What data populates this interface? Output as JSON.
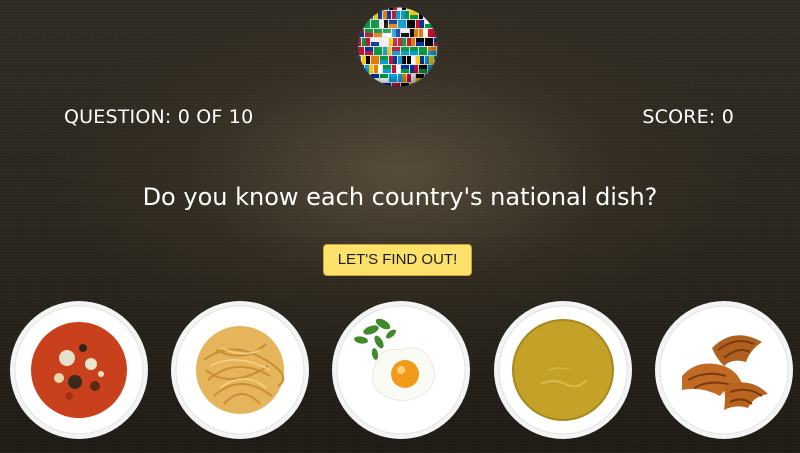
{
  "header": {
    "logo_icon": "flag-globe-icon"
  },
  "hud": {
    "question_counter": "QUESTION: 0 OF 10",
    "score": "SCORE: 0"
  },
  "prompt": {
    "text": "Do you know each country's national dish?"
  },
  "start_button": {
    "label": "LET'S FIND OUT!",
    "color": "#fce26a"
  },
  "dishes": [
    {
      "icon": "tomato-stew-plate-icon"
    },
    {
      "icon": "spaghetti-plate-icon"
    },
    {
      "icon": "fried-egg-plate-icon"
    },
    {
      "icon": "yellow-soup-plate-icon"
    },
    {
      "icon": "croissants-plate-icon"
    }
  ]
}
